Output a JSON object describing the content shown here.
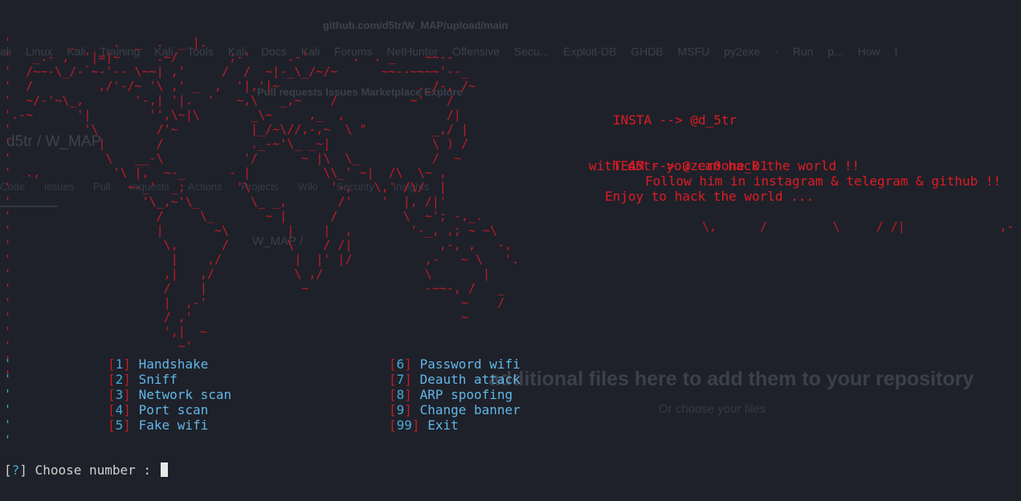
{
  "background": {
    "url": "github.com/d5tr/W_MAP/upload/main",
    "bookmarks": "ali Linux   Kali Training   Kali Tools   Kali Docs   Kali Forums   NetHunter   Offensive Secu...   Exploit-DB   GHDB   MSFU   py2exe - Run p...   How t",
    "nav": "Pull requests   Issues   Marketplace   Explore",
    "repo": "d5tr / W_MAP",
    "tabs": "Code   Issues   Pull requests   Actions   Projects   Wiki   Security   Insights",
    "path": "W_MAP /",
    "drop_text": "additional files here to add them to your repository",
    "choose_files": "Or choose your files"
  },
  "banner": {
    "ascii_map": "'        _     .  _  .  _ |.\n'   _.- ,  '|=|~     .~/       ;-'     .-'      .  . _    ~~--\n'  /~~-\\_/-`~-'-- \\~~| ,'     /  /  ~|-_\\_/~/~      ~~--~~~~'--_\n'  /         ,/'-/~ '\\ ,' _  ,  '|,'|~                   ._/-, /~\n'  ~/-'~\\_,       '-,| '|.  '   ~,\\   _,~    /          ~'   /\n'.-~      '|        '',\\~|\\       _\\~     ,_  ,              /|\n'          '\\        /'~          |_/~\\//,-,~  \\ \"         _,/ |\n'            |       /            ._-~'\\_ _~|              \\ ) /\n'             \\   __-\\           '/      ~ |\\  \\_          /  ~\n'  .,          '\\ |,  ~-_      - |          \\\\_' ~|  /\\  \\~ ,\n'                ~-_'  _;       '\\           '-,   \\,' /\\/  |\n'                  '\\_,~'\\_       \\_ _,       /'    '  |, /|'\n'                    /     \\_       ~ |      /         \\  ~'; -,_.\n'                    |       ~\\        |    |  ,        '-_, ,; ~ ~\\\n'                     \\,      /        \\    / /|            ,-, ,   -,\n'                      |    ,/          |  |' |/          ,-   ~ \\   '.\n'                     ,|   ,/           \\ ,/              \\       |\n'                     /    |             ~                -~~-, /   _\n'                     |  ,-'                                   ~    /\n'                     / ,'                                     ~\n'                     ',|  ~\n'                       ~'\n'\n'",
    "art_tail": "\\,      /         \\     / /|             ,-",
    "insta": "INSTA --> @d_5tr",
    "team": "TEAM --> @zer0one_01",
    "tagline": "with d5tr you can hack the world !!",
    "follow": "Follow him in instagram & telegram & github !!",
    "enjoy": "Enjoy to hack the world ...",
    "ticks": "'\n'\n'\n'\n'\n'"
  },
  "menu": {
    "left": [
      {
        "num": "1",
        "label": "Handshake"
      },
      {
        "num": "2",
        "label": "Sniff"
      },
      {
        "num": "3",
        "label": "Network scan"
      },
      {
        "num": "4",
        "label": "Port scan"
      },
      {
        "num": "5",
        "label": "Fake wifi"
      }
    ],
    "right": [
      {
        "num": "6",
        "label": "Password wifi"
      },
      {
        "num": "7",
        "label": "Deauth attack"
      },
      {
        "num": "8",
        "label": "ARP spoofing"
      },
      {
        "num": "9",
        "label": "Change banner"
      },
      {
        "num": "99",
        "label": "Exit"
      }
    ]
  },
  "prompt": {
    "open": "[",
    "mark": "?",
    "close": "]",
    "text": " Choose number : "
  },
  "colors": {
    "background": "#1e2129",
    "banner_red": "#c01c28",
    "menu_blue": "#62b6e8"
  }
}
